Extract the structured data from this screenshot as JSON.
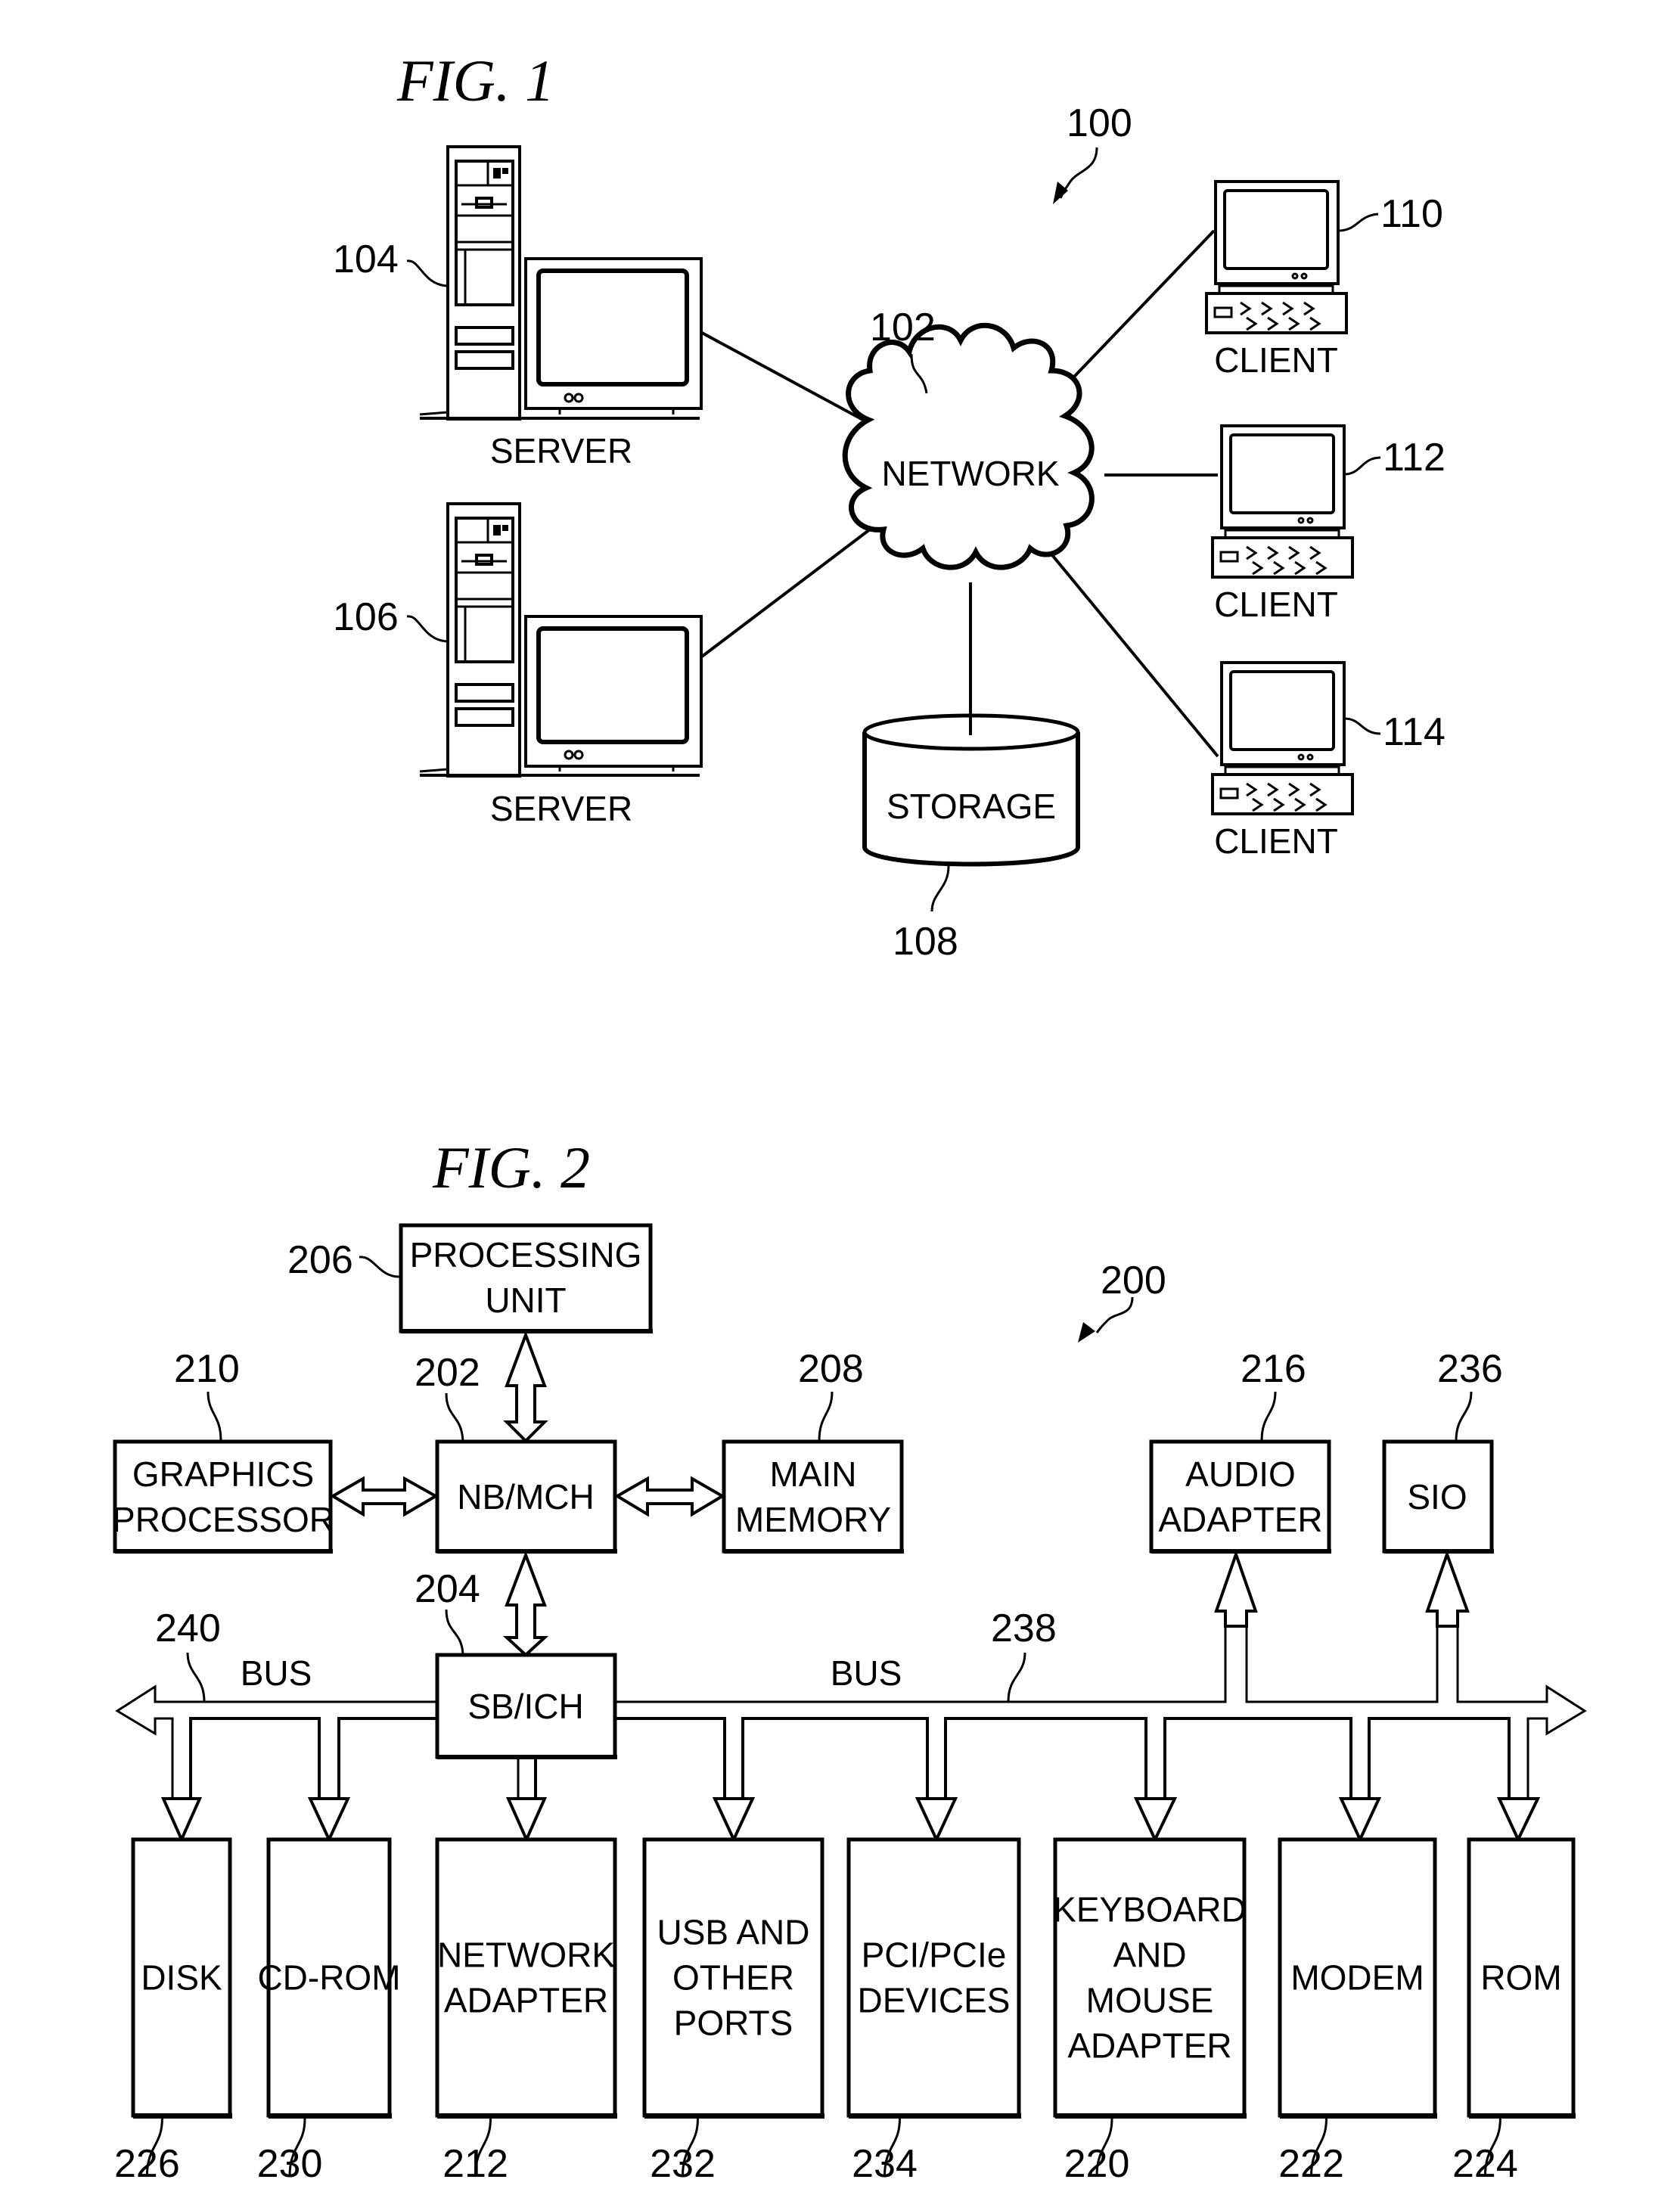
{
  "figures": [
    {
      "id": "fig1",
      "title": "FIG. 1",
      "system_ref": "100",
      "network": {
        "label": "NETWORK",
        "ref": "102"
      },
      "servers": [
        {
          "label": "SERVER",
          "ref": "104"
        },
        {
          "label": "SERVER",
          "ref": "106"
        }
      ],
      "storage": {
        "label": "STORAGE",
        "ref": "108"
      },
      "clients": [
        {
          "label": "CLIENT",
          "ref": "110"
        },
        {
          "label": "CLIENT",
          "ref": "112"
        },
        {
          "label": "CLIENT",
          "ref": "114"
        }
      ]
    },
    {
      "id": "fig2",
      "title": "FIG. 2",
      "system_ref": "200",
      "top_blocks": {
        "processing_unit": {
          "lines": [
            "PROCESSING",
            "UNIT"
          ],
          "ref": "206"
        },
        "nb_mch": {
          "lines": [
            "NB/MCH"
          ],
          "ref": "202"
        },
        "graphics_processor": {
          "lines": [
            "GRAPHICS",
            "PROCESSOR"
          ],
          "ref": "210"
        },
        "main_memory": {
          "lines": [
            "MAIN",
            "MEMORY"
          ],
          "ref": "208"
        },
        "sb_ich": {
          "lines": [
            "SB/ICH"
          ],
          "ref": "204"
        },
        "audio_adapter": {
          "lines": [
            "AUDIO",
            "ADAPTER"
          ],
          "ref": "216"
        },
        "sio": {
          "lines": [
            "SIO"
          ],
          "ref": "236"
        }
      },
      "buses": [
        {
          "label": "BUS",
          "ref": "240"
        },
        {
          "label": "BUS",
          "ref": "238"
        }
      ],
      "bottom_blocks": [
        {
          "lines": [
            "DISK"
          ],
          "ref": "226"
        },
        {
          "lines": [
            "CD-ROM"
          ],
          "ref": "230"
        },
        {
          "lines": [
            "NETWORK",
            "ADAPTER"
          ],
          "ref": "212"
        },
        {
          "lines": [
            "USB AND",
            "OTHER",
            "PORTS"
          ],
          "ref": "232"
        },
        {
          "lines": [
            "PCI/PCIe",
            "DEVICES"
          ],
          "ref": "234"
        },
        {
          "lines": [
            "KEYBOARD",
            "AND",
            "MOUSE",
            "ADAPTER"
          ],
          "ref": "220"
        },
        {
          "lines": [
            "MODEM"
          ],
          "ref": "222"
        },
        {
          "lines": [
            "ROM"
          ],
          "ref": "224"
        }
      ]
    }
  ]
}
